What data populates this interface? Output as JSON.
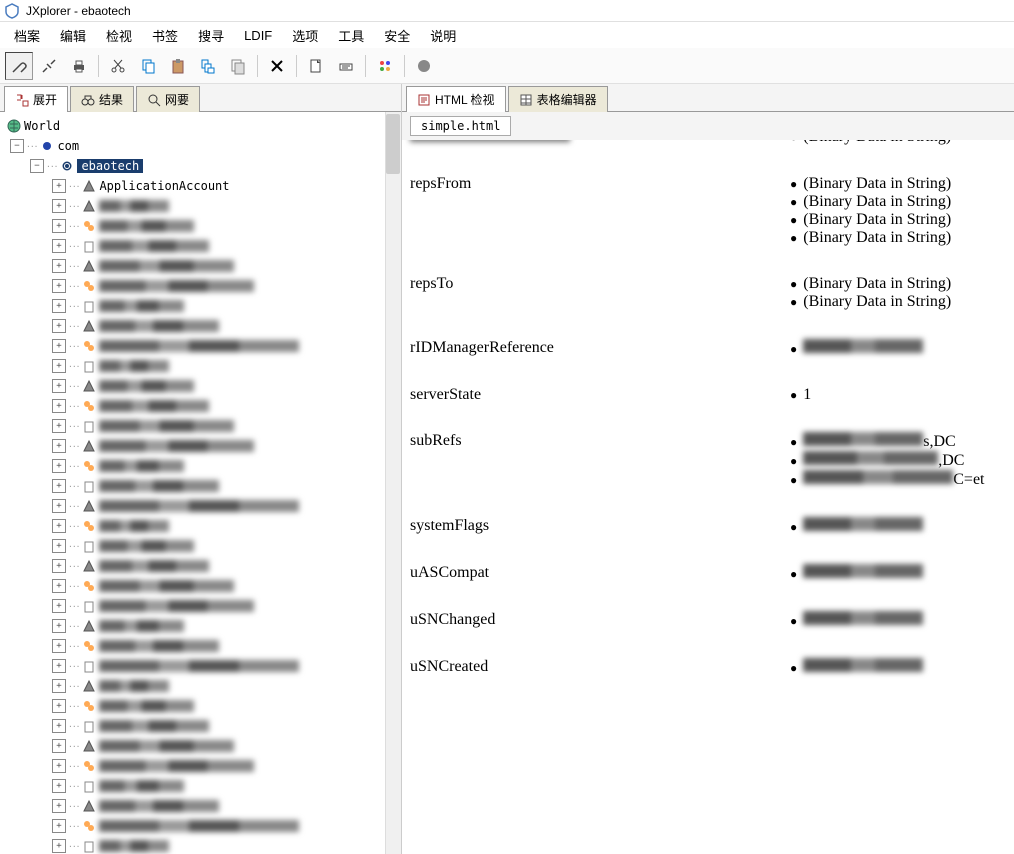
{
  "window": {
    "title": "JXplorer - ebaotech"
  },
  "menu": {
    "items": [
      "档案",
      "编辑",
      "检视",
      "书签",
      "搜寻",
      "LDIF",
      "选项",
      "工具",
      "安全",
      "说明"
    ]
  },
  "toolbar": {
    "icons": [
      {
        "name": "connect-icon",
        "seg": 0
      },
      {
        "name": "disconnect-icon",
        "seg": 0
      },
      {
        "name": "print-icon",
        "seg": 0
      },
      {
        "name": "cut-icon",
        "seg": 1
      },
      {
        "name": "copy-icon",
        "seg": 1
      },
      {
        "name": "paste-icon",
        "seg": 1
      },
      {
        "name": "copy-dn-icon",
        "seg": 1
      },
      {
        "name": "copy-entry-icon",
        "seg": 1
      },
      {
        "name": "delete-icon",
        "seg": 2
      },
      {
        "name": "new-entry-icon",
        "seg": 3
      },
      {
        "name": "rename-icon",
        "seg": 3
      },
      {
        "name": "refresh-icon",
        "seg": 4
      },
      {
        "name": "stop-icon",
        "seg": 5
      }
    ]
  },
  "left_tabs": {
    "items": [
      {
        "icon": "expand-icon",
        "label": "展开"
      },
      {
        "icon": "binoculars-icon",
        "label": "结果"
      },
      {
        "icon": "magnifier-icon",
        "label": "网要"
      }
    ],
    "active": 0
  },
  "tree": {
    "root": "World",
    "l1": "com",
    "selected": "ebaotech",
    "child1": "ApplicationAccount",
    "blurred_count": 33
  },
  "right_tabs": {
    "items": [
      {
        "icon": "html-icon",
        "label": "HTML 检视"
      },
      {
        "icon": "table-icon",
        "label": "表格编辑器"
      }
    ],
    "active": 0
  },
  "html_file": "simple.html",
  "attrs": [
    {
      "name": "",
      "top_cut": true,
      "values": [
        "(Binary Data in String)"
      ],
      "blur_vals": false,
      "blur_name": true
    },
    {
      "gap": true
    },
    {
      "name": "repsFrom",
      "values": [
        "(Binary Data in String)",
        "(Binary Data in String)",
        "(Binary Data in String)",
        "(Binary Data in String)"
      ]
    },
    {
      "gap": true
    },
    {
      "name": "repsTo",
      "values": [
        "(Binary Data in String)",
        "(Binary Data in String)"
      ]
    },
    {
      "gap": true
    },
    {
      "name": "rIDManagerReference",
      "values": [
        ""
      ],
      "blur_vals": true
    },
    {
      "gap": true
    },
    {
      "name": "serverState",
      "values": [
        "1"
      ]
    },
    {
      "gap": true
    },
    {
      "name": "subRefs",
      "values": [
        "",
        "",
        ""
      ],
      "blur_vals": true,
      "suffix": [
        "s,DC",
        ",DC",
        "C=et"
      ]
    },
    {
      "gap": true
    },
    {
      "name": "systemFlags",
      "values": [
        ""
      ],
      "blur_vals": true
    },
    {
      "gap": true
    },
    {
      "name": "uASCompat",
      "values": [
        ""
      ],
      "blur_vals": true
    },
    {
      "gap": true
    },
    {
      "name": "uSNChanged",
      "values": [
        ""
      ],
      "blur_vals": true
    },
    {
      "gap": true
    },
    {
      "name": "uSNCreated",
      "values": [
        ""
      ],
      "blur_vals": true
    }
  ]
}
